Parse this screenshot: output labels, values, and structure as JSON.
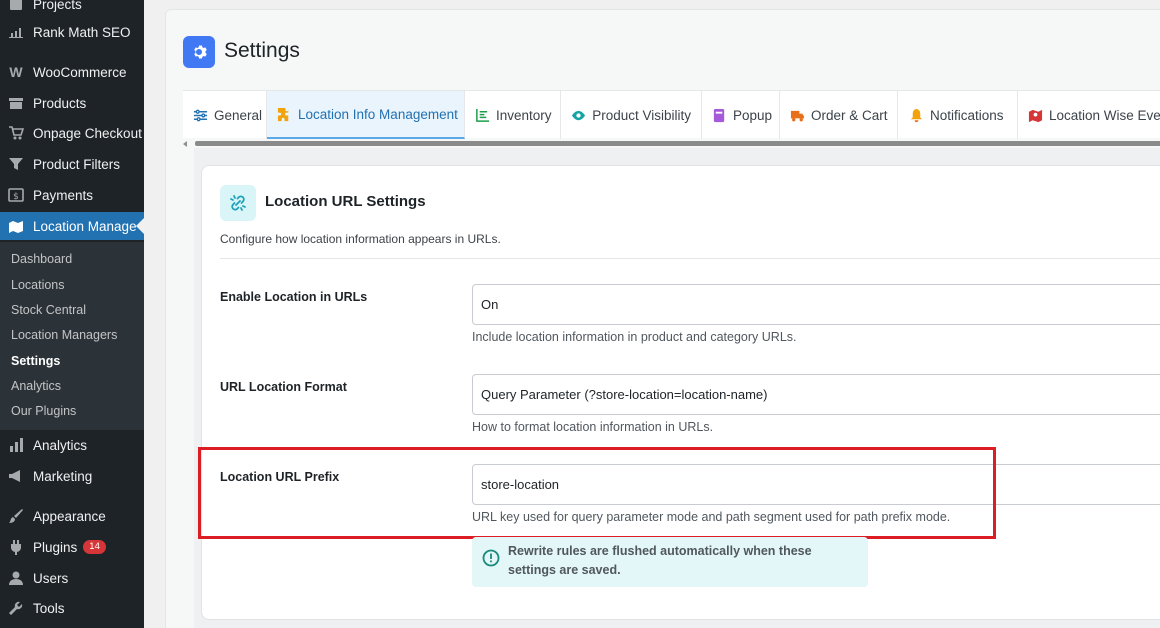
{
  "sidebar": {
    "items": [
      {
        "label": "Projects",
        "icon": "projects-icon"
      },
      {
        "label": "Rank Math SEO",
        "icon": "rank-math-icon"
      },
      {
        "label": "WooCommerce",
        "icon": "woocommerce-icon"
      },
      {
        "label": "Products",
        "icon": "products-icon"
      },
      {
        "label": "Onpage Checkout",
        "icon": "cart-icon"
      },
      {
        "label": "Product Filters",
        "icon": "filter-icon"
      },
      {
        "label": "Payments",
        "icon": "payments-icon"
      },
      {
        "label": "Location Manage",
        "icon": "location-manage-icon"
      },
      {
        "label": "Analytics",
        "icon": "analytics-icon"
      },
      {
        "label": "Marketing",
        "icon": "marketing-icon"
      },
      {
        "label": "Appearance",
        "icon": "appearance-icon"
      },
      {
        "label": "Plugins",
        "icon": "plugins-icon",
        "badge": "14"
      },
      {
        "label": "Users",
        "icon": "users-icon"
      },
      {
        "label": "Tools",
        "icon": "tools-icon"
      }
    ],
    "submenu": [
      {
        "label": "Dashboard"
      },
      {
        "label": "Locations"
      },
      {
        "label": "Stock Central"
      },
      {
        "label": "Location Managers"
      },
      {
        "label": "Settings",
        "active": true
      },
      {
        "label": "Analytics"
      },
      {
        "label": "Our Plugins"
      }
    ]
  },
  "page": {
    "title": "Settings",
    "tabs": [
      {
        "label": "General",
        "icon": "sliders-icon"
      },
      {
        "label": "Location Info Management",
        "icon": "puzzle-icon",
        "active": true
      },
      {
        "label": "Inventory",
        "icon": "chart-line-icon"
      },
      {
        "label": "Product Visibility",
        "icon": "eye-icon"
      },
      {
        "label": "Popup",
        "icon": "popup-icon"
      },
      {
        "label": "Order & Cart",
        "icon": "truck-icon"
      },
      {
        "label": "Notifications",
        "icon": "bell-icon"
      },
      {
        "label": "Location Wise Every",
        "icon": "map-pin-icon"
      }
    ]
  },
  "section": {
    "title": "Location URL Settings",
    "description": "Configure how location information appears in URLs.",
    "fields": [
      {
        "label": "Enable Location in URLs",
        "value": "On",
        "help": "Include location information in product and category URLs."
      },
      {
        "label": "URL Location Format",
        "value": "Query Parameter (?store-location=location-name)",
        "help": "How to format location information in URLs."
      },
      {
        "label": "Location URL Prefix",
        "value": "store-location",
        "help": "URL key used for query parameter mode and path segment used for path prefix mode."
      }
    ],
    "notice": "Rewrite rules are flushed automatically when these settings are saved."
  },
  "colors": {
    "sidebar_bg": "#1d2327",
    "accent": "#2271b1",
    "highlight": "#dc1e24",
    "notice_bg": "#e3f6f8"
  }
}
